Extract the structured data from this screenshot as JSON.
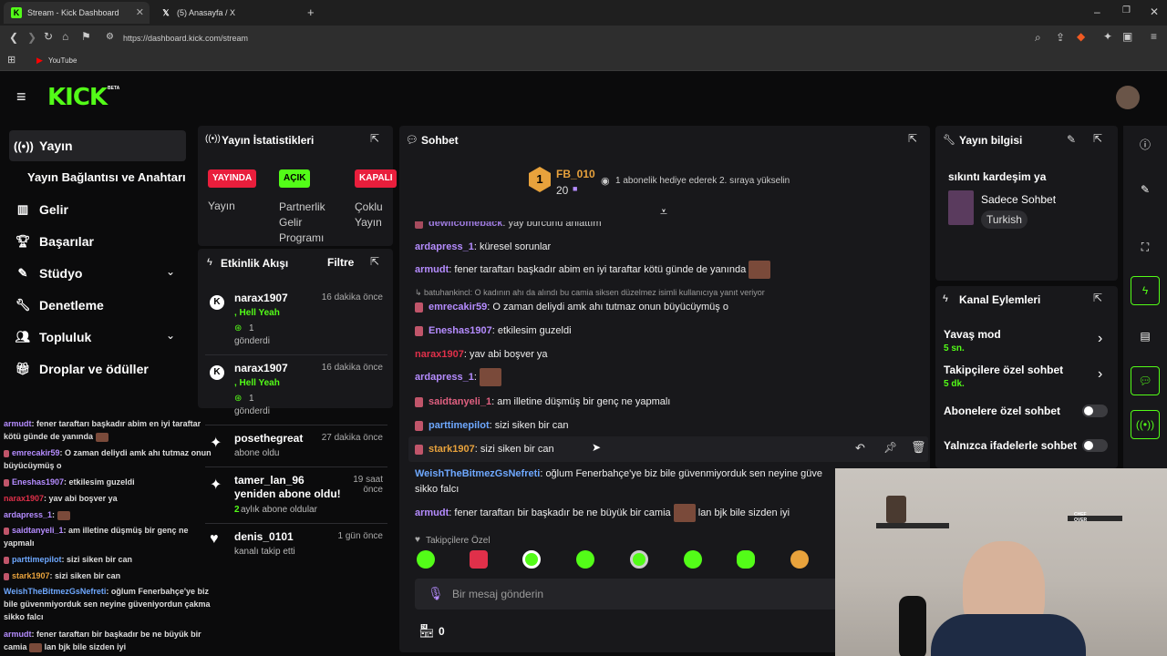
{
  "browser": {
    "tabs": [
      {
        "label": "Stream - Kick Dashboard",
        "active": true
      },
      {
        "label": "(5) Anasayfa / X",
        "active": false
      }
    ],
    "url": "https://dashboard.kick.com/stream",
    "bookmark": "YouTube"
  },
  "brand": {
    "logo": "KICK",
    "beta": "BETA",
    "accent": "#53fc18"
  },
  "sidebar": {
    "items": [
      {
        "label": "Yayın",
        "icon": "broadcast-icon"
      },
      {
        "label": "Yayın Bağlantısı ve Anahtarı",
        "icon": ""
      },
      {
        "label": "Gelir",
        "icon": "chart-icon"
      },
      {
        "label": "Başarılar",
        "icon": "trophy-icon"
      },
      {
        "label": "Stüdyo",
        "icon": "brush-icon"
      },
      {
        "label": "Denetleme",
        "icon": "wrench-icon"
      },
      {
        "label": "Topluluk",
        "icon": "users-icon"
      },
      {
        "label": "Droplar ve ödüller",
        "icon": "gift-icon"
      }
    ]
  },
  "mini_chat": [
    {
      "user": "armudt",
      "text": ": fener taraftarı başkadır abim en iyi taraftar kötü günde de yanında",
      "color": "#b58cff"
    },
    {
      "user": "emrecakir59",
      "text": ": O zaman deliydi amk ahı tutmaz onun büyücüymüş o",
      "color": "#b58cff"
    },
    {
      "user": "Eneshas1907",
      "text": ": etkilesim guzeldi",
      "color": "#b58cff"
    },
    {
      "user": "narax1907",
      "text": ": yav abi boşver ya",
      "color": "#e0304a"
    },
    {
      "user": "ardapress_1",
      "text": ":",
      "color": "#b58cff"
    },
    {
      "user": "saidtanyeli_1",
      "text": ": am illetine düşmüş bir genç ne yapmalı",
      "color": "#b58cff"
    },
    {
      "user": "parttimepilot",
      "text": ": sizi siken bir can",
      "color": "#6ea8ff"
    },
    {
      "user": "stark1907",
      "text": ": sizi siken bir can",
      "color": "#e8a23c"
    },
    {
      "user": "WeishTheBitmezGsNefreti",
      "text": ": oğlum Fenerbahçe'ye biz bile güvenmiyorduk sen neyine güveniyordun çakma sikko falcı",
      "color": "#6ea8ff"
    },
    {
      "user": "armudt",
      "text": ": fener taraftarı bir başkadır be ne büyük bir camia",
      "tail": "lan bjk bile sizden iyi",
      "color": "#b58cff"
    }
  ],
  "stats": {
    "title": "Yayın İstatistikleri",
    "badges": [
      {
        "label": "YAYINDA",
        "color": "#e91e3c",
        "caption": "Yayın"
      },
      {
        "label": "AÇIK",
        "color": "#53fc18",
        "caption": "Partnerlik Gelir Programı"
      },
      {
        "label": "KAPALI",
        "color": "#e91e3c",
        "caption": "Çoklu Yayın"
      }
    ]
  },
  "activity": {
    "title": "Etkinlik Akışı",
    "filter": "Filtre",
    "events": [
      {
        "name": "narax1907",
        "sub1": ", Hell Yeah",
        "sub2": "1",
        "sub3": "gönderdi",
        "time": "16 dakika önce"
      },
      {
        "name": "narax1907",
        "sub1": ", Hell Yeah",
        "sub2": "1",
        "sub3": "gönderdi",
        "time": "16 dakika önce"
      },
      {
        "name": "posethegreat",
        "sub1": "abone oldu",
        "time": "27 dakika önce"
      },
      {
        "name": "tamer_lan_96 yeniden abone oldu!",
        "sub1": "2",
        "sub2": " aylık abone oldular",
        "time": "19 saat önce"
      },
      {
        "name": "denis_0101",
        "sub1": "kanalı takip etti",
        "time": "1 gün önce"
      }
    ]
  },
  "chat": {
    "title": "Sohbet",
    "leader": {
      "rank": "1",
      "name": "FB_010",
      "count": "20",
      "note": "1 abonelik hediye ederek 2. sıraya yükselin"
    },
    "partial_top": {
      "user": "dewilcomeback",
      "text": ": yay burcunu anlattım"
    },
    "messages": [
      {
        "user": "ardapress_1",
        "text": ": küresel sorunlar",
        "color": "#b58cff",
        "badge": false
      },
      {
        "user": "armudt",
        "text": ": fener taraftarı başkadır abim en iyi taraftar kötü günde de yanında",
        "color": "#b58cff",
        "badge": false,
        "emote": true
      },
      {
        "reply": "batuhankincl: O kadının ahı da alındı bu camia siksen düzelmez isimli kullanıcıya yanıt veriyor"
      },
      {
        "user": "emrecakir59",
        "text": ": O zaman deliydi amk ahı tutmaz onun büyücüymüş o",
        "color": "#b58cff",
        "badge": true
      },
      {
        "user": "Eneshas1907",
        "text": ": etkilesim guzeldi",
        "color": "#b58cff",
        "badge": true
      },
      {
        "user": "narax1907",
        "text": ": yav abi boşver ya",
        "color": "#e0304a",
        "badge": false
      },
      {
        "user": "ardapress_1",
        "text": ":",
        "color": "#b58cff",
        "badge": false,
        "emote": true
      },
      {
        "user": "saidtanyeli_1",
        "text": ": am illetine düşmüş bir genç ne yapmalı",
        "color": "#e06080",
        "badge": true
      },
      {
        "user": "parttimepilot",
        "text": ": sizi siken bir can",
        "color": "#6ea8ff",
        "badge": true
      },
      {
        "user": "stark1907",
        "text": ": sizi siken bir can",
        "color": "#e8a23c",
        "badge": true
      },
      {
        "user": "WeishTheBitmezGsNefreti",
        "text": ": oğlum Fenerbahçe'ye biz bile güvenmiyorduk sen neyine güve",
        "text2": "sikko falcı",
        "color": "#6ea8ff",
        "badge": false
      },
      {
        "user": "armudt",
        "text": ": fener taraftarı bir başkadır be ne büyük bir camia",
        "tail": "lan bjk bile sizden iyi",
        "color": "#b58cff",
        "badge": false,
        "emote": true
      }
    ],
    "followers_only": "Takipçilere Özel",
    "input_placeholder": "Bir mesaj gönderin",
    "shop_count": "0"
  },
  "stream_info": {
    "title": "Yayın bilgisi",
    "stream_title": "sıkıntı kardeşim ya",
    "category": "Sadece Sohbet",
    "language": "Turkish"
  },
  "channel_actions": {
    "title": "Kanal Eylemleri",
    "items": [
      {
        "label": "Yavaş mod",
        "value": "5 sn.",
        "type": "arrow"
      },
      {
        "label": "Takipçilere özel sohbet",
        "value": "5 dk.",
        "type": "arrow"
      },
      {
        "label": "Abonelere özel sohbet",
        "type": "toggle"
      },
      {
        "label": "Yalnızca ifadelerle sohbet",
        "type": "toggle"
      }
    ]
  },
  "webcam": {
    "sign": "CHEF OVER"
  }
}
